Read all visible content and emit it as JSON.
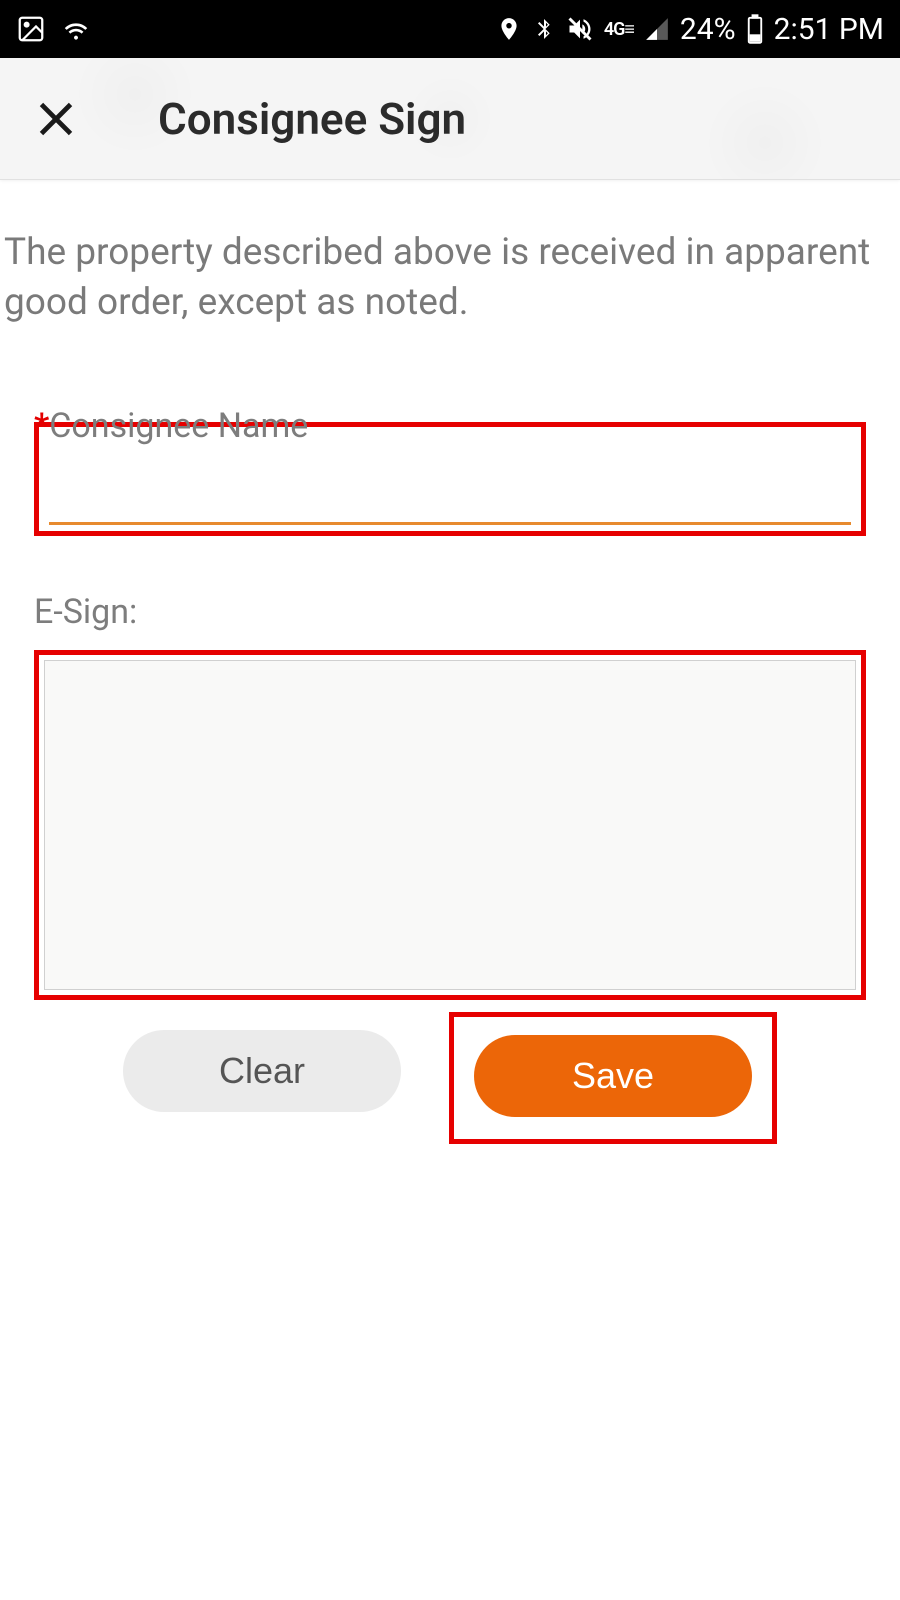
{
  "statusBar": {
    "battery": "24%",
    "time": "2:51 PM",
    "network": "4G"
  },
  "header": {
    "title": "Consignee Sign"
  },
  "body": {
    "description": "The property described above is received in apparent good order, except as noted.",
    "consigneeNameLabel": "Consignee Name",
    "consigneeNameValue": "",
    "esignLabel": "E-Sign:",
    "clearButton": "Clear",
    "saveButton": "Save"
  }
}
